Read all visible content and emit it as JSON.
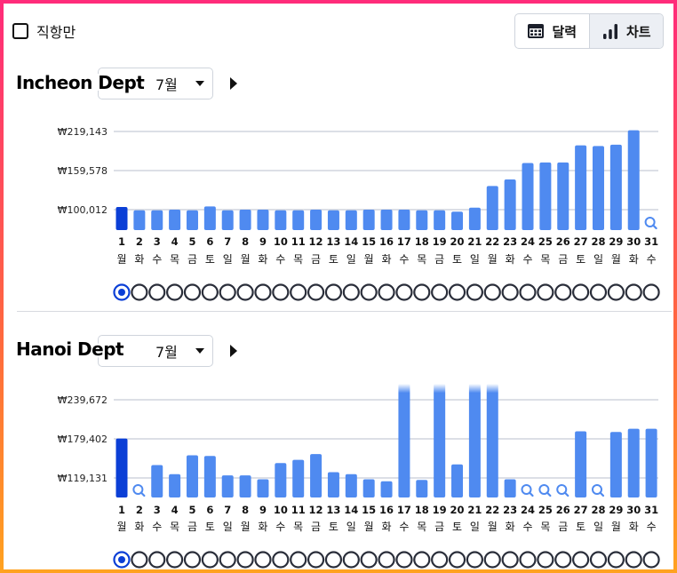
{
  "topbar": {
    "direct_only_label": "직항만",
    "view_calendar_label": "달력",
    "view_chart_label": "차트",
    "calendar_icon": "calendar-icon",
    "chart_icon": "bar-chart-icon"
  },
  "colors": {
    "bar": "#4f8af0",
    "bar_selected": "#0b3fd6",
    "grid": "#b8bfcc",
    "search_icon": "#4f8af0",
    "dot_border": "#2a2e3a",
    "dot_selected": "#0b3fd6"
  },
  "sections": [
    {
      "route_title": "Incheon Dept",
      "month": "7월",
      "chart_data": {
        "type": "bar",
        "y_ticks": [
          "₩219,143",
          "₩159,578",
          "₩100,012"
        ],
        "y_tick_values": [
          219143,
          159578,
          100012
        ],
        "days": [
          "1",
          "2",
          "3",
          "4",
          "5",
          "6",
          "7",
          "8",
          "9",
          "10",
          "11",
          "12",
          "13",
          "14",
          "15",
          "16",
          "17",
          "18",
          "19",
          "20",
          "21",
          "22",
          "23",
          "24",
          "25",
          "26",
          "27",
          "28",
          "29",
          "30",
          "31"
        ],
        "weekdays": [
          "월",
          "화",
          "수",
          "목",
          "금",
          "토",
          "일",
          "월",
          "화",
          "수",
          "목",
          "금",
          "토",
          "일",
          "월",
          "화",
          "수",
          "목",
          "금",
          "토",
          "일",
          "월",
          "화",
          "수",
          "목",
          "금",
          "토",
          "일",
          "월",
          "화",
          "수"
        ],
        "values": [
          104000,
          99000,
          99000,
          100000,
          99000,
          105000,
          99000,
          100000,
          100000,
          99000,
          99000,
          100000,
          99000,
          99000,
          100000,
          100000,
          100000,
          99000,
          99000,
          97000,
          103000,
          136000,
          146000,
          171000,
          172000,
          172000,
          198000,
          197000,
          199000,
          221000,
          null
        ],
        "selected_day": "1",
        "no_data_icon": "search-icon"
      }
    },
    {
      "route_title": "Hanoi Dept",
      "month": "7월",
      "chart_data": {
        "type": "bar",
        "y_ticks": [
          "₩239,672",
          "₩179,402",
          "₩119,131"
        ],
        "y_tick_values": [
          239672,
          179402,
          119131
        ],
        "days": [
          "1",
          "2",
          "3",
          "4",
          "5",
          "6",
          "7",
          "8",
          "9",
          "10",
          "11",
          "12",
          "13",
          "14",
          "15",
          "16",
          "17",
          "18",
          "19",
          "20",
          "21",
          "22",
          "23",
          "24",
          "25",
          "26",
          "27",
          "28",
          "29",
          "30",
          "31"
        ],
        "weekdays": [
          "월",
          "화",
          "수",
          "목",
          "금",
          "토",
          "일",
          "월",
          "화",
          "수",
          "목",
          "금",
          "토",
          "일",
          "월",
          "화",
          "수",
          "목",
          "금",
          "토",
          "일",
          "월",
          "화",
          "수",
          "목",
          "금",
          "토",
          "일",
          "월",
          "화",
          "수"
        ],
        "values": [
          180000,
          null,
          139000,
          125000,
          154000,
          153000,
          123000,
          123000,
          117000,
          142000,
          147000,
          156000,
          128000,
          125000,
          117000,
          114000,
          270000,
          116000,
          270000,
          140000,
          270000,
          270000,
          117000,
          null,
          null,
          null,
          191000,
          null,
          190000,
          195000,
          195000
        ],
        "selected_day": "1",
        "no_data_icon": "search-icon"
      }
    }
  ]
}
